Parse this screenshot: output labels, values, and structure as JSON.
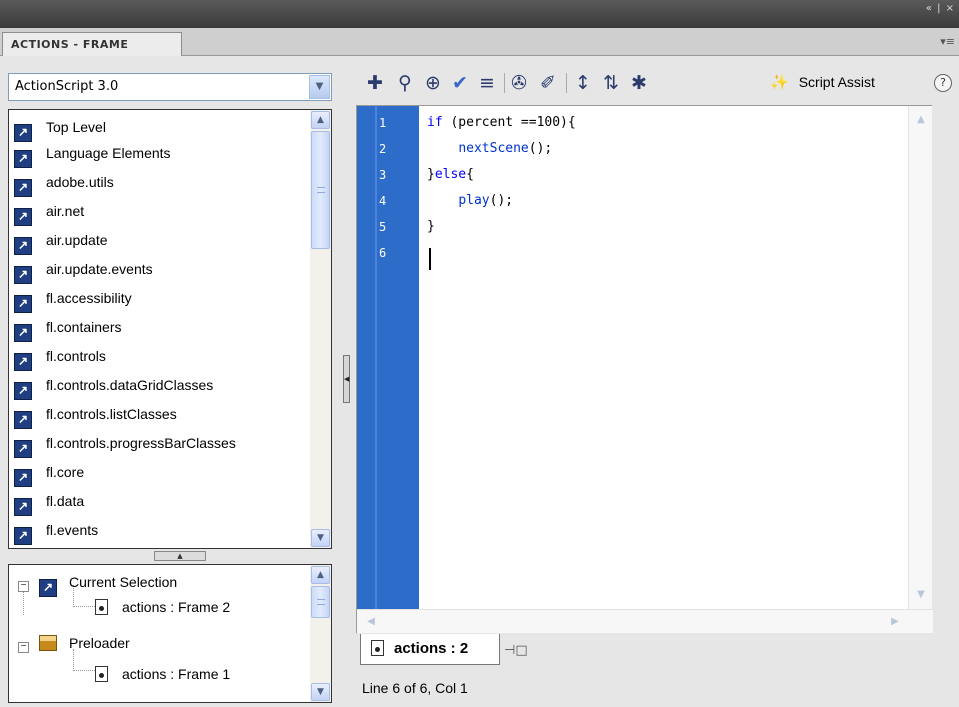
{
  "window": {
    "controls": "« | ×",
    "panel_tab": "ACTIONS - FRAME",
    "panel_menu": "▾≡"
  },
  "language_select": {
    "value": "ActionScript 3.0"
  },
  "toolbox": {
    "items": [
      "Top Level",
      "Language Elements",
      "adobe.utils",
      "air.net",
      "air.update",
      "air.update.events",
      "fl.accessibility",
      "fl.containers",
      "fl.controls",
      "fl.controls.dataGridClasses",
      "fl.controls.listClasses",
      "fl.controls.progressBarClasses",
      "fl.core",
      "fl.data",
      "fl.events"
    ]
  },
  "script_navigator": {
    "current_selection": "Current Selection",
    "current_frame": "actions : Frame 2",
    "scene": "Preloader",
    "scene_frame": "actions : Frame 1"
  },
  "toolbar": {
    "icons": [
      "add-statement-icon",
      "find-icon",
      "target-path-icon",
      "check-syntax-icon",
      "auto-format-icon",
      "code-hint-icon",
      "debug-options-icon",
      "collapse-braces-icon",
      "collapse-selection-icon",
      "expand-all-icon"
    ],
    "script_assist_label": "Script Assist",
    "help_label": "?"
  },
  "editor": {
    "line_numbers": [
      "1",
      "2",
      "3",
      "4",
      "5",
      "6"
    ],
    "lines": [
      {
        "indent": "",
        "keyword": "if",
        "rest": " (percent ==100){"
      },
      {
        "indent": "    ",
        "keyword": "",
        "func": "nextScene",
        "rest": "();"
      },
      {
        "indent": "",
        "keyword": "",
        "rest": "}",
        "keyword2": "else",
        "rest2": "{"
      },
      {
        "indent": "    ",
        "keyword": "",
        "func": "play",
        "rest": "();"
      },
      {
        "indent": "",
        "keyword": "",
        "rest": "}"
      },
      {
        "indent": "",
        "keyword": "",
        "rest": ""
      }
    ]
  },
  "script_tab": {
    "label": "actions : 2"
  },
  "status": {
    "text": "Line 6 of 6, Col 1"
  },
  "colors": {
    "gutter": "#2e6cc9",
    "keyword": "#0000ff",
    "panel_bg": "#e6e6e6"
  }
}
